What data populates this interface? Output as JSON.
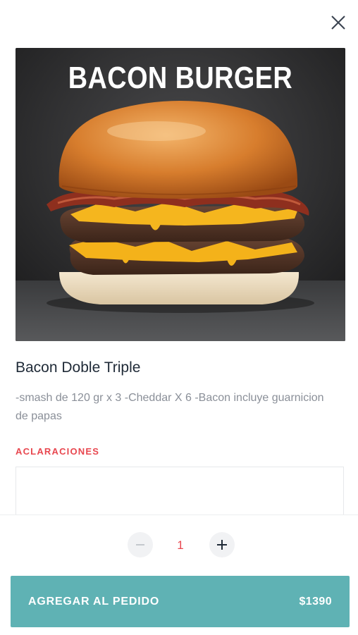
{
  "modal": {
    "close_icon": "close-icon"
  },
  "photo": {
    "title_text": "BACON BURGER"
  },
  "product": {
    "name": "Bacon Doble Triple",
    "description": "-smash de 120 gr x 3 -Cheddar X 6 -Bacon incluye guarnicion de papas"
  },
  "notes": {
    "label": "ACLARACIONES",
    "value": ""
  },
  "quantity": {
    "value": "1",
    "minus_icon": "minus-icon",
    "plus_icon": "plus-icon"
  },
  "add_button": {
    "label": "AGREGAR AL PEDIDO",
    "price": "$1390"
  },
  "colors": {
    "accent": "#5fb2b4",
    "label_red": "#e8474f",
    "text_dark": "#1f2a37",
    "text_muted": "#8a8f98"
  }
}
